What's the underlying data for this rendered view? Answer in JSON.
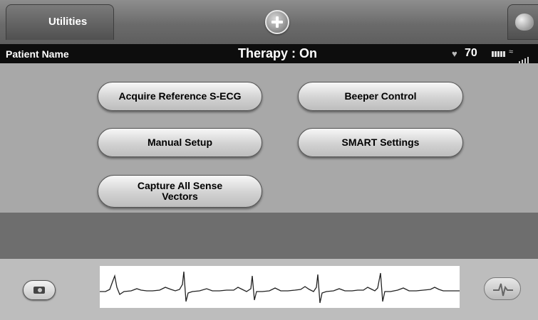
{
  "header": {
    "tab_label": "Utilities"
  },
  "status": {
    "patient_label": "Patient Name",
    "therapy": "Therapy : On",
    "heart_rate": "70"
  },
  "buttons": {
    "acquire_ref": "Acquire Reference S-ECG",
    "beeper_control": "Beeper Control",
    "manual_setup": "Manual Setup",
    "smart_settings": "SMART Settings",
    "capture_all_line1": "Capture All Sense",
    "capture_all_line2": "Vectors"
  },
  "icons": {
    "add": "plus-icon",
    "device": "device-icon",
    "heart": "heart-icon",
    "battery": "battery-icon",
    "wireless": "wireless-icon",
    "signal": "signal-strength-icon",
    "snapshot": "camera-icon",
    "shock": "shock-icon"
  },
  "colors": {
    "status_bar": "#0d0d0d",
    "panel": "#a8a8a8",
    "band": "#6e6e6e",
    "ecg_strip": "#ffffff"
  }
}
